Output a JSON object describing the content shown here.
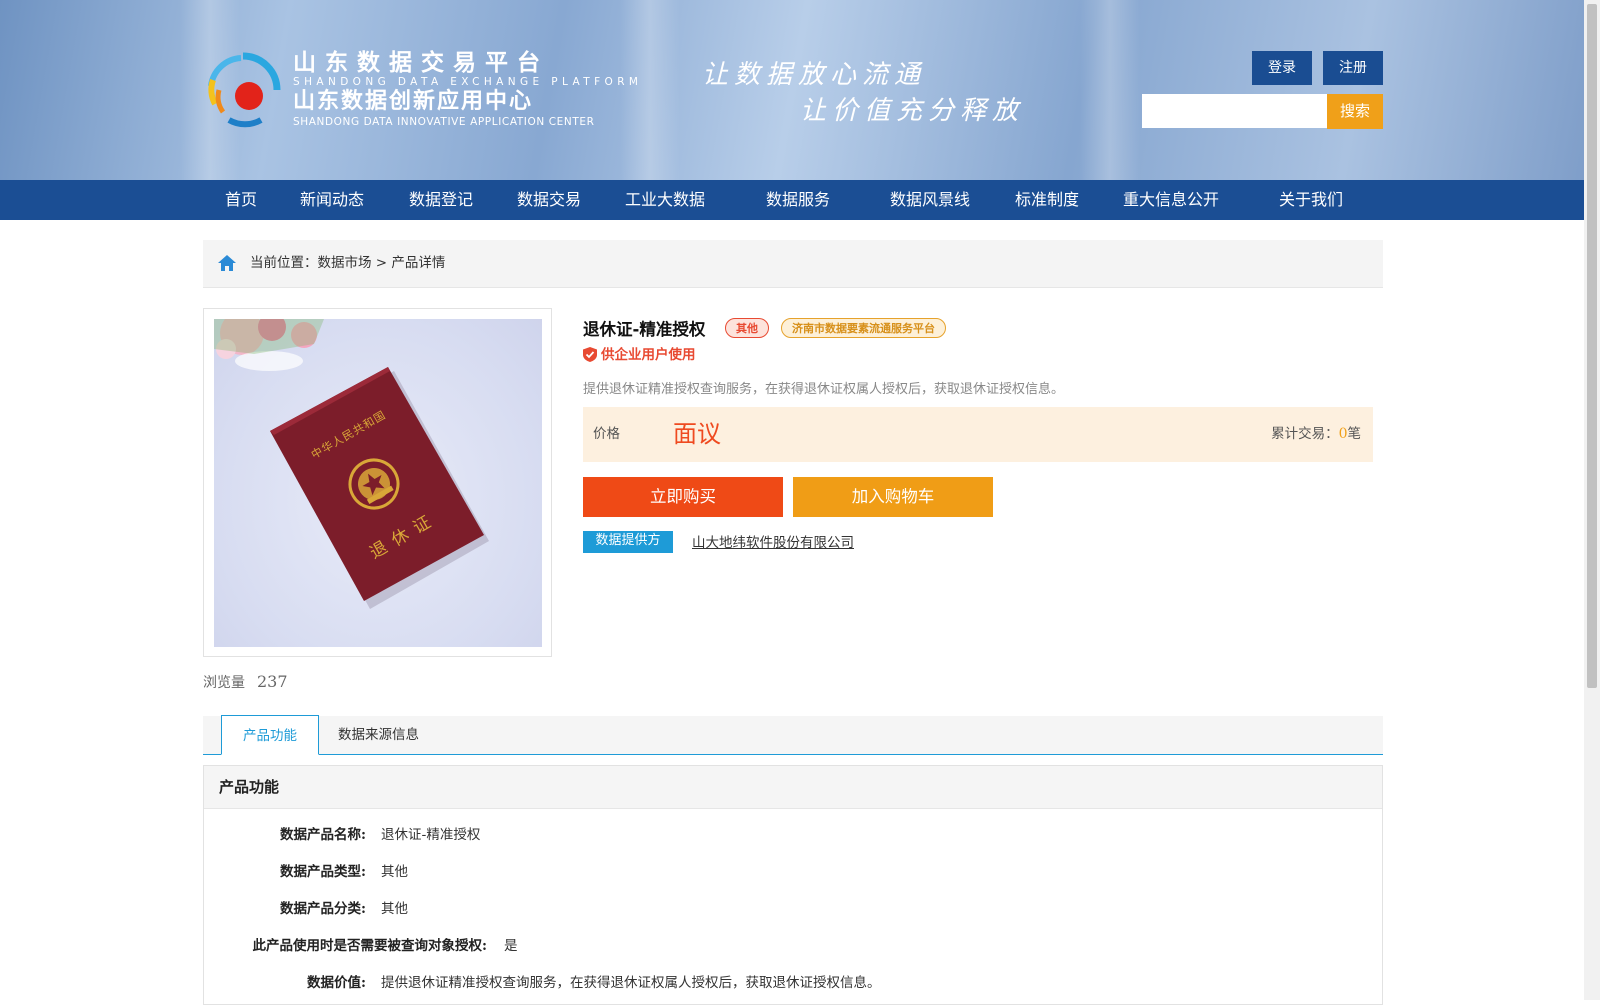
{
  "header": {
    "logo_cn_line1": "山东数据交易平台",
    "logo_en_line1": "SHANDONG DATA EXCHANGE PLATFORM",
    "logo_cn_line2": "山东数据创新应用中心",
    "logo_en_line2": "SHANDONG DATA INNOVATIVE APPLICATION CENTER",
    "slogan_line1": "让数据放心流通",
    "slogan_line2": "让价值充分释放",
    "login_label": "登录",
    "register_label": "注册",
    "search_placeholder": "",
    "search_button_label": "搜索"
  },
  "nav": {
    "items": [
      "首页",
      "新闻动态",
      "数据登记",
      "数据交易",
      "工业大数据",
      "数据服务",
      "数据风景线",
      "标准制度",
      "重大信息公开",
      "关于我们"
    ]
  },
  "breadcrumb": {
    "prefix": "当前位置：",
    "market": "数据市场",
    "separator": " > ",
    "current": "产品详情"
  },
  "product": {
    "title": "退休证-精准授权",
    "tag_category": "其他",
    "tag_platform": "济南市数据要素流通服务平台",
    "usage_note": "供企业用户使用",
    "description": "提供退休证精准授权查询服务，在获得退休证权属人授权后，获取退休证授权信息。",
    "price_label": "价格",
    "price_value": "面议",
    "trade_prefix": "累计交易：",
    "trade_count": "0",
    "trade_unit": "笔",
    "buy_label": "立即购买",
    "cart_label": "加入购物车",
    "provider_tag": "数据提供方",
    "provider_name": "山大地纬软件股份有限公司",
    "views_label": "浏览量",
    "views_count": "237",
    "image": {
      "cover_text_top": "中华人民共和国",
      "cover_text_bottom": "退休证",
      "cover_color": "#7c1d2a"
    }
  },
  "tabs": [
    {
      "label": "产品功能",
      "active": true
    },
    {
      "label": "数据来源信息",
      "active": false
    }
  ],
  "section": {
    "title": "产品功能",
    "fields": [
      {
        "label": "数据产品名称:",
        "value": "退休证-精准授权"
      },
      {
        "label": "数据产品类型:",
        "value": "其他"
      },
      {
        "label": "数据产品分类:",
        "value": "其他"
      },
      {
        "label": "此产品使用时是否需要被查询对象授权:",
        "value": "是"
      },
      {
        "label": "数据价值:",
        "value": "提供退休证精准授权查询服务，在获得退休证权属人授权后，获取退休证授权信息。"
      }
    ]
  },
  "colors": {
    "nav_blue": "#1b4e94",
    "accent_orange": "#f0a019",
    "buy_red": "#ef4a16",
    "link_blue": "#1e9bd7"
  }
}
